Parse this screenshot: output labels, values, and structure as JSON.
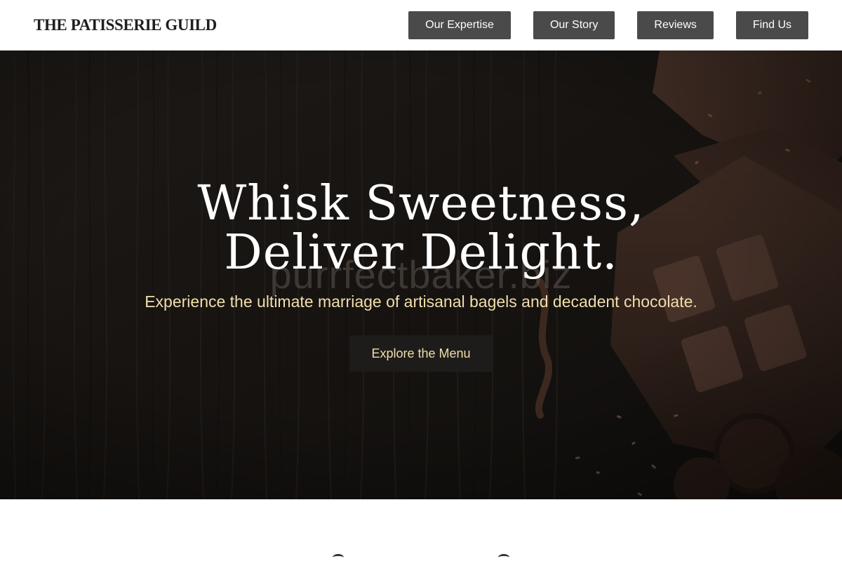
{
  "header": {
    "brand": "THE PATISSERIE GUILD",
    "nav": [
      {
        "label": "Our Expertise"
      },
      {
        "label": "Our Story"
      },
      {
        "label": "Reviews"
      },
      {
        "label": "Find Us"
      }
    ]
  },
  "hero": {
    "headline_line1": "Whisk Sweetness,",
    "headline_line2": "Deliver Delight.",
    "subtitle": "Experience the ultimate marriage of artisanal bagels and decadent chocolate.",
    "cta_label": "Explore the Menu",
    "watermark": "purrfectbaker.biz",
    "background": "chocolate-on-dark-wood"
  },
  "colors": {
    "accent_gold": "#f1deab",
    "nav_button": "#4a4a4a",
    "cta_background": "#1e1c1b",
    "brand_text": "#1f1f1f"
  }
}
